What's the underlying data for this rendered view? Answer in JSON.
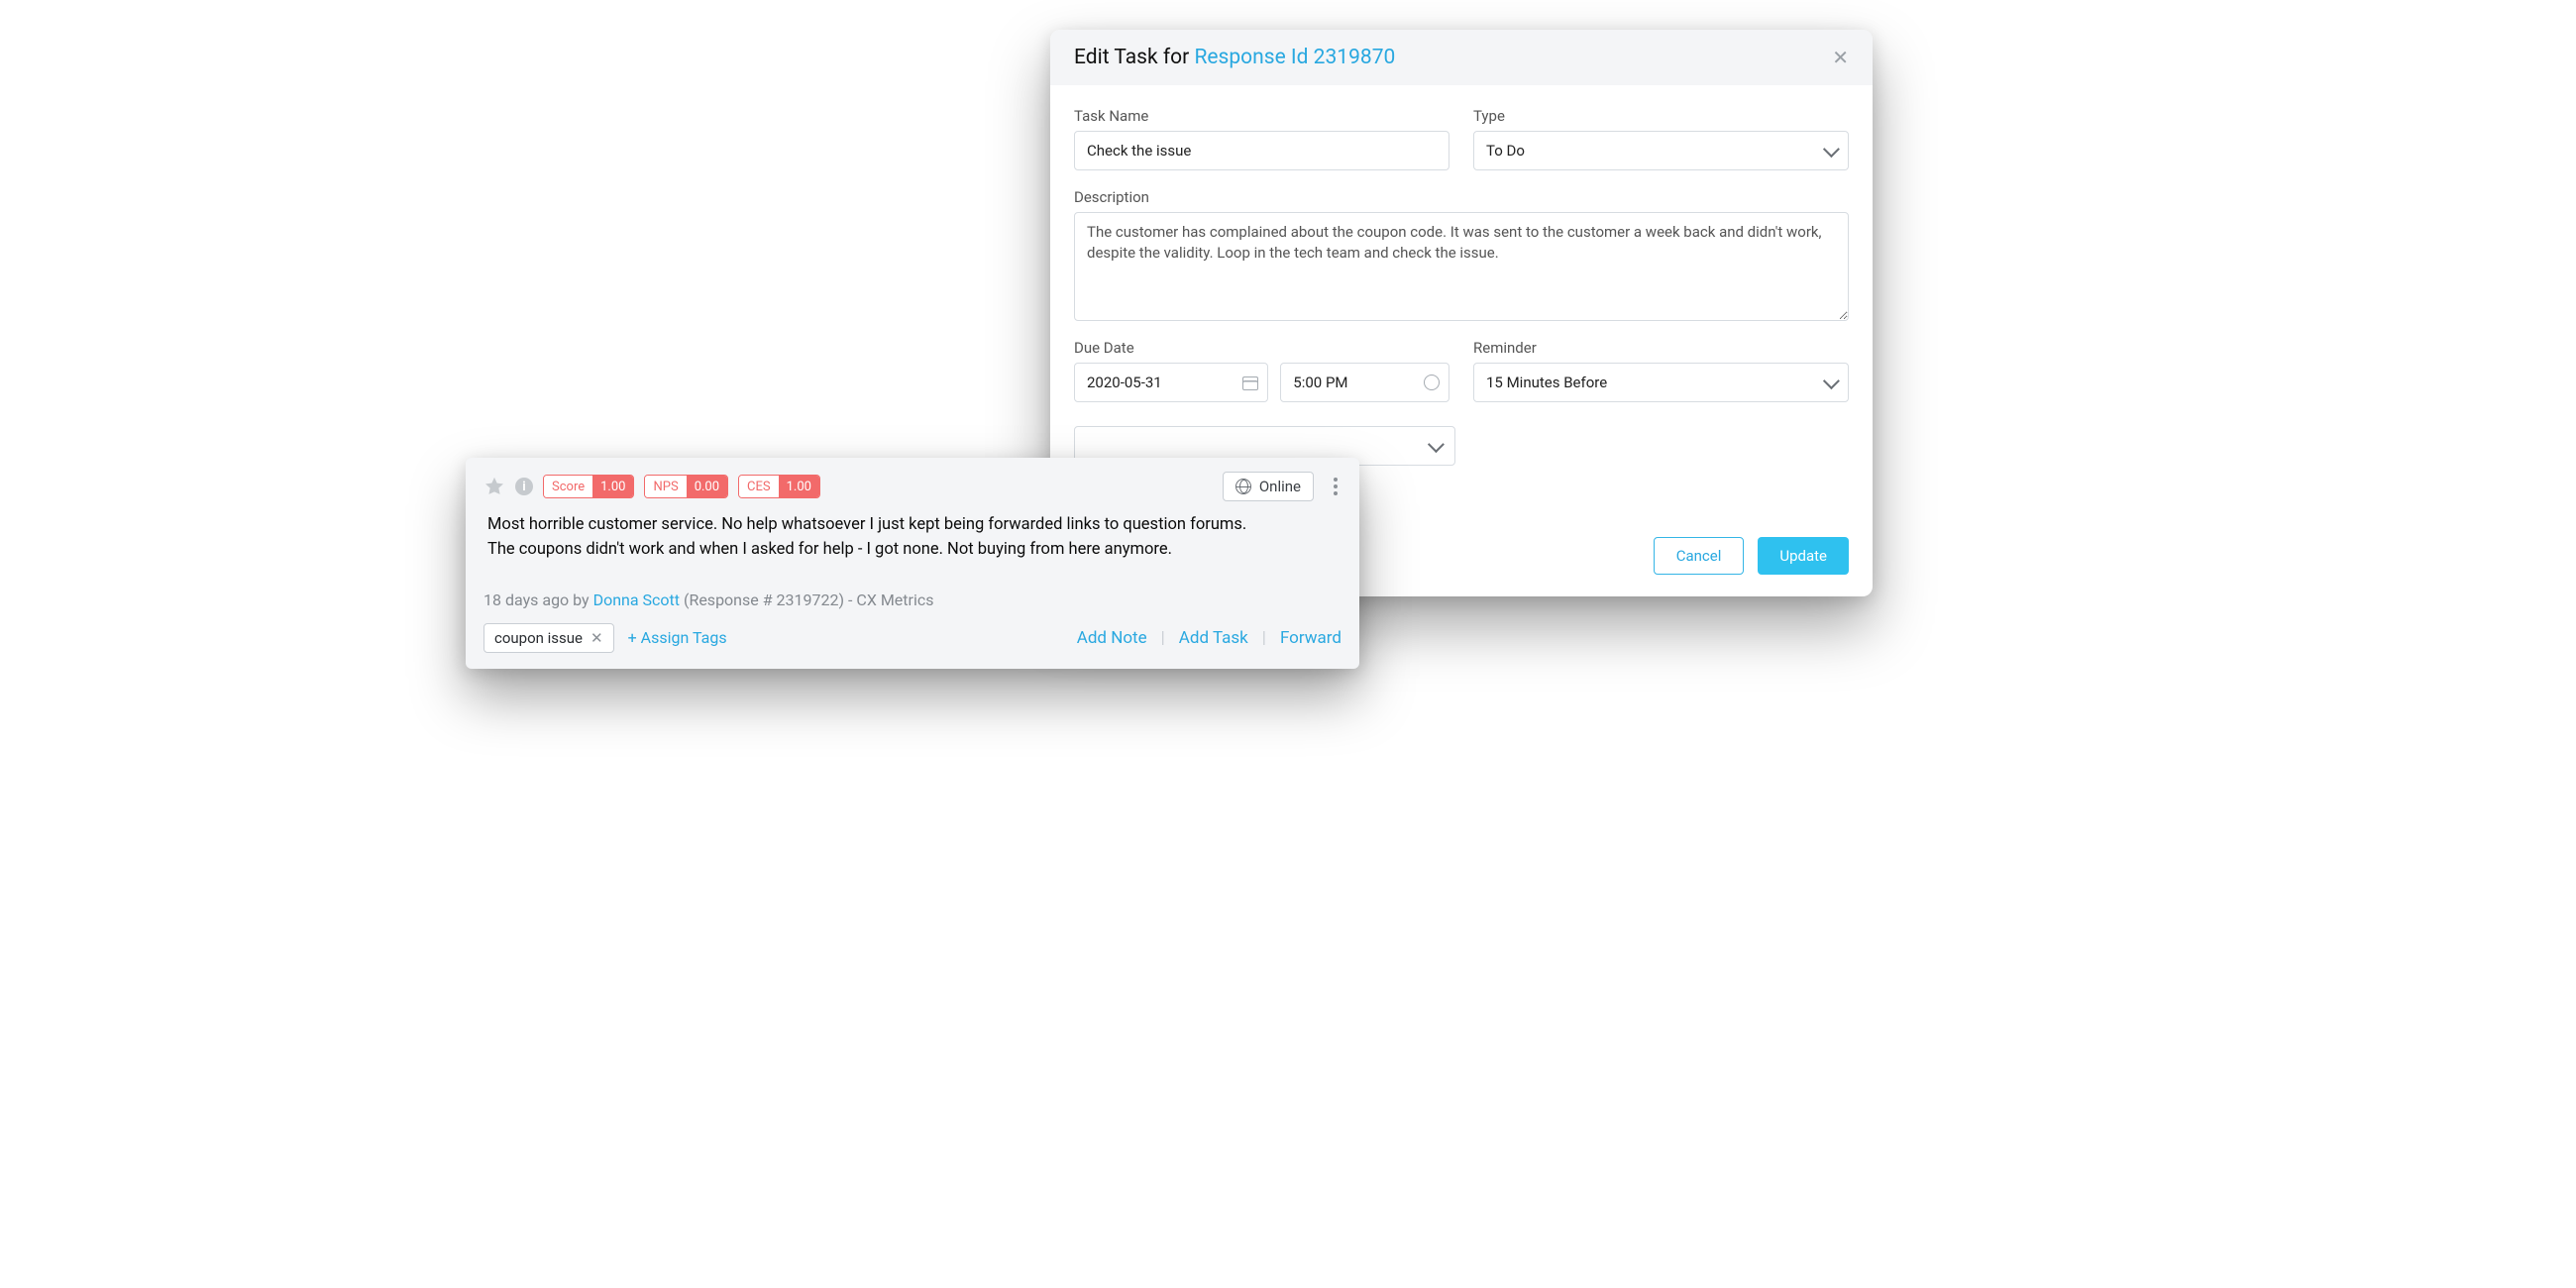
{
  "modal": {
    "title_prefix": "Edit Task for ",
    "title_link": "Response Id 2319870",
    "task_name_label": "Task Name",
    "task_name_value": "Check the issue",
    "type_label": "Type",
    "type_value": "To Do",
    "description_label": "Description",
    "description_value": "The customer has complained about the coupon code. It was sent to the customer a week back and didn't work, despite the validity. Loop in the tech team and check the issue.",
    "due_date_label": "Due Date",
    "due_date_value": "2020-05-31",
    "due_time_value": "5:00 PM",
    "reminder_label": "Reminder",
    "reminder_value": "15 Minutes Before",
    "cancel_label": "Cancel",
    "update_label": "Update"
  },
  "card": {
    "badges": {
      "score_label": "Score",
      "score_value": "1.00",
      "nps_label": "NPS",
      "nps_value": "0.00",
      "ces_label": "CES",
      "ces_value": "1.00"
    },
    "channel": "Online",
    "message_line1": "Most horrible customer service. No help whatsoever I just kept being forwarded links to question forums.",
    "message_line2": "The coupons didn't  work and when I asked for help - I got none. Not buying from here anymore.",
    "meta_prefix": "18 days ago by ",
    "meta_author": "Donna Scott",
    "meta_suffix": " (Response # 2319722) - CX Metrics",
    "tag": "coupon issue",
    "assign_tags": "+ Assign Tags",
    "actions": {
      "add_note": "Add Note",
      "add_task": "Add Task",
      "forward": "Forward"
    }
  }
}
